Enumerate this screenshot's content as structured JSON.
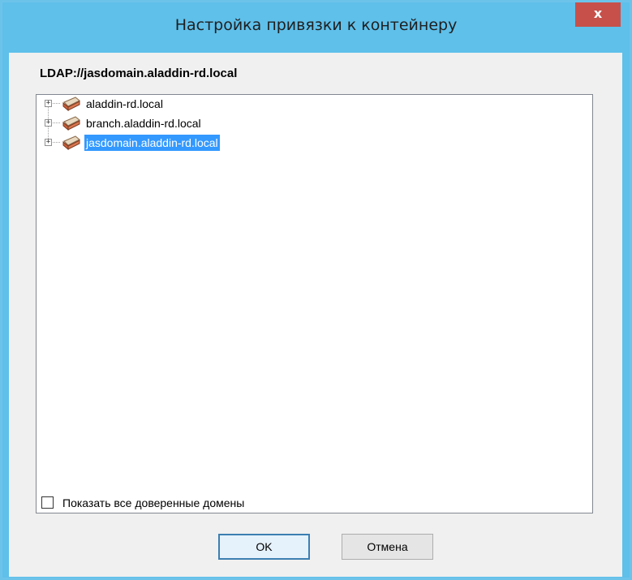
{
  "window": {
    "title": "Настройка привязки к контейнеру",
    "close_label": "x"
  },
  "path_label": "LDAP://jasdomain.aladdin-rd.local",
  "tree": {
    "items": [
      {
        "label": "aladdin-rd.local",
        "expander": "+",
        "icon": "domain-icon",
        "selected": false
      },
      {
        "label": "branch.aladdin-rd.local",
        "expander": "+",
        "icon": "domain-icon",
        "selected": false
      },
      {
        "label": "jasdomain.aladdin-rd.local",
        "expander": "+",
        "icon": "domain-icon",
        "selected": true
      }
    ]
  },
  "show_all_trusted": {
    "label": "Показать все доверенные домены",
    "checked": false
  },
  "buttons": {
    "ok_label": "OK",
    "cancel_label": "Отмена"
  },
  "colors": {
    "title_bar": "#5fc0ea",
    "close_button": "#c7504a",
    "selection": "#3399ff",
    "dialog_bg": "#f0f0f0"
  }
}
